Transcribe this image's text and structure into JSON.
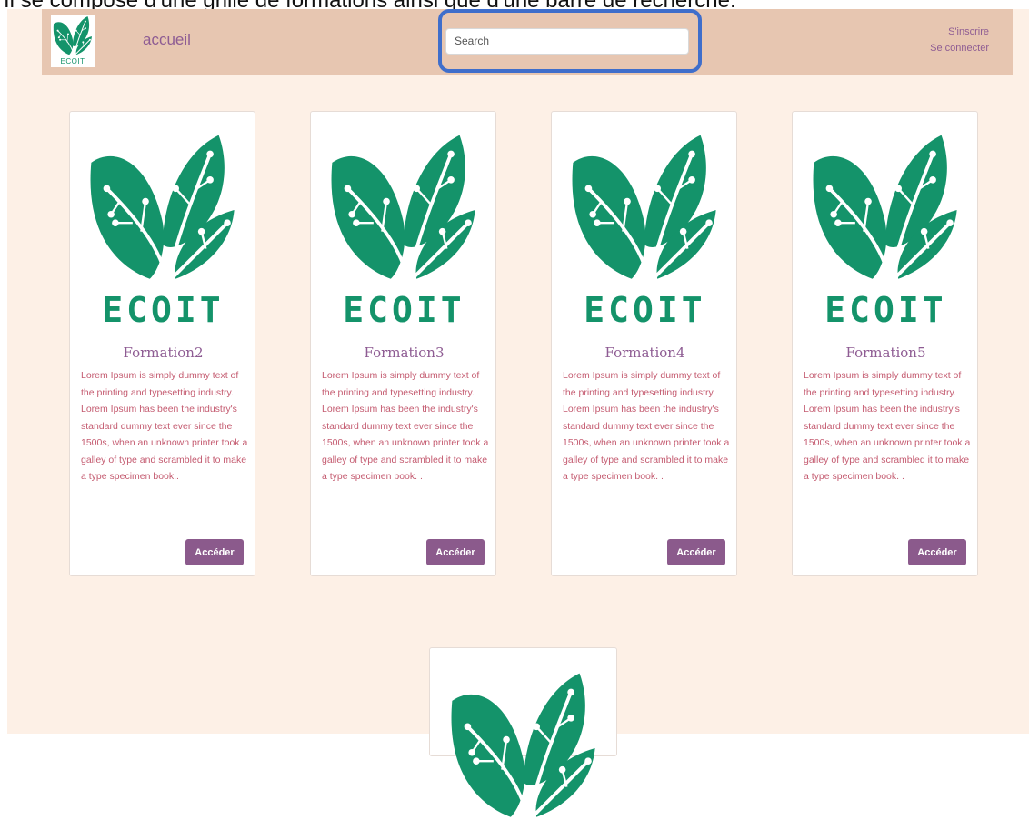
{
  "caption": "Il se compose d'une grille de formations ainsi que d'une barre de recherche.",
  "navbar": {
    "logo_text": "ECOIT",
    "home_label": "accueil",
    "search_placeholder": "Search",
    "signup_label": "S'inscrire",
    "login_label": "Se connecter"
  },
  "colors": {
    "navbar_bg": "#e7c6b1",
    "page_bg": "#fdf0e6",
    "brand_green": "#14936a",
    "accent_purple": "#8b5a8c",
    "text_pink": "#c45b70",
    "highlight_blue": "#3f6ecb"
  },
  "cards": [
    {
      "brand": "ECOIT",
      "title": "Formation2",
      "description": "Lorem Ipsum is simply dummy text of the printing and typesetting industry. Lorem Ipsum has been the industry's standard dummy text ever since the 1500s, when an unknown printer took a galley of type and scrambled it to make a type specimen book..",
      "button_label": "Accéder"
    },
    {
      "brand": "ECOIT",
      "title": "Formation3",
      "description": "Lorem Ipsum is simply dummy text of the printing and typesetting industry. Lorem Ipsum has been the industry's standard dummy text ever since the 1500s, when an unknown printer took a galley of type and scrambled it to make a type specimen book. .",
      "button_label": "Accéder"
    },
    {
      "brand": "ECOIT",
      "title": "Formation4",
      "description": "Lorem Ipsum is simply dummy text of the printing and typesetting industry. Lorem Ipsum has been the industry's standard dummy text ever since the 1500s, when an unknown printer took a galley of type and scrambled it to make a type specimen book. .",
      "button_label": "Accéder"
    },
    {
      "brand": "ECOIT",
      "title": "Formation5",
      "description": "Lorem Ipsum is simply dummy text of the printing and typesetting industry. Lorem Ipsum has been the industry's standard dummy text ever since the 1500s, when an unknown printer took a galley of type and scrambled it to make a type specimen book. .",
      "button_label": "Accéder"
    }
  ]
}
